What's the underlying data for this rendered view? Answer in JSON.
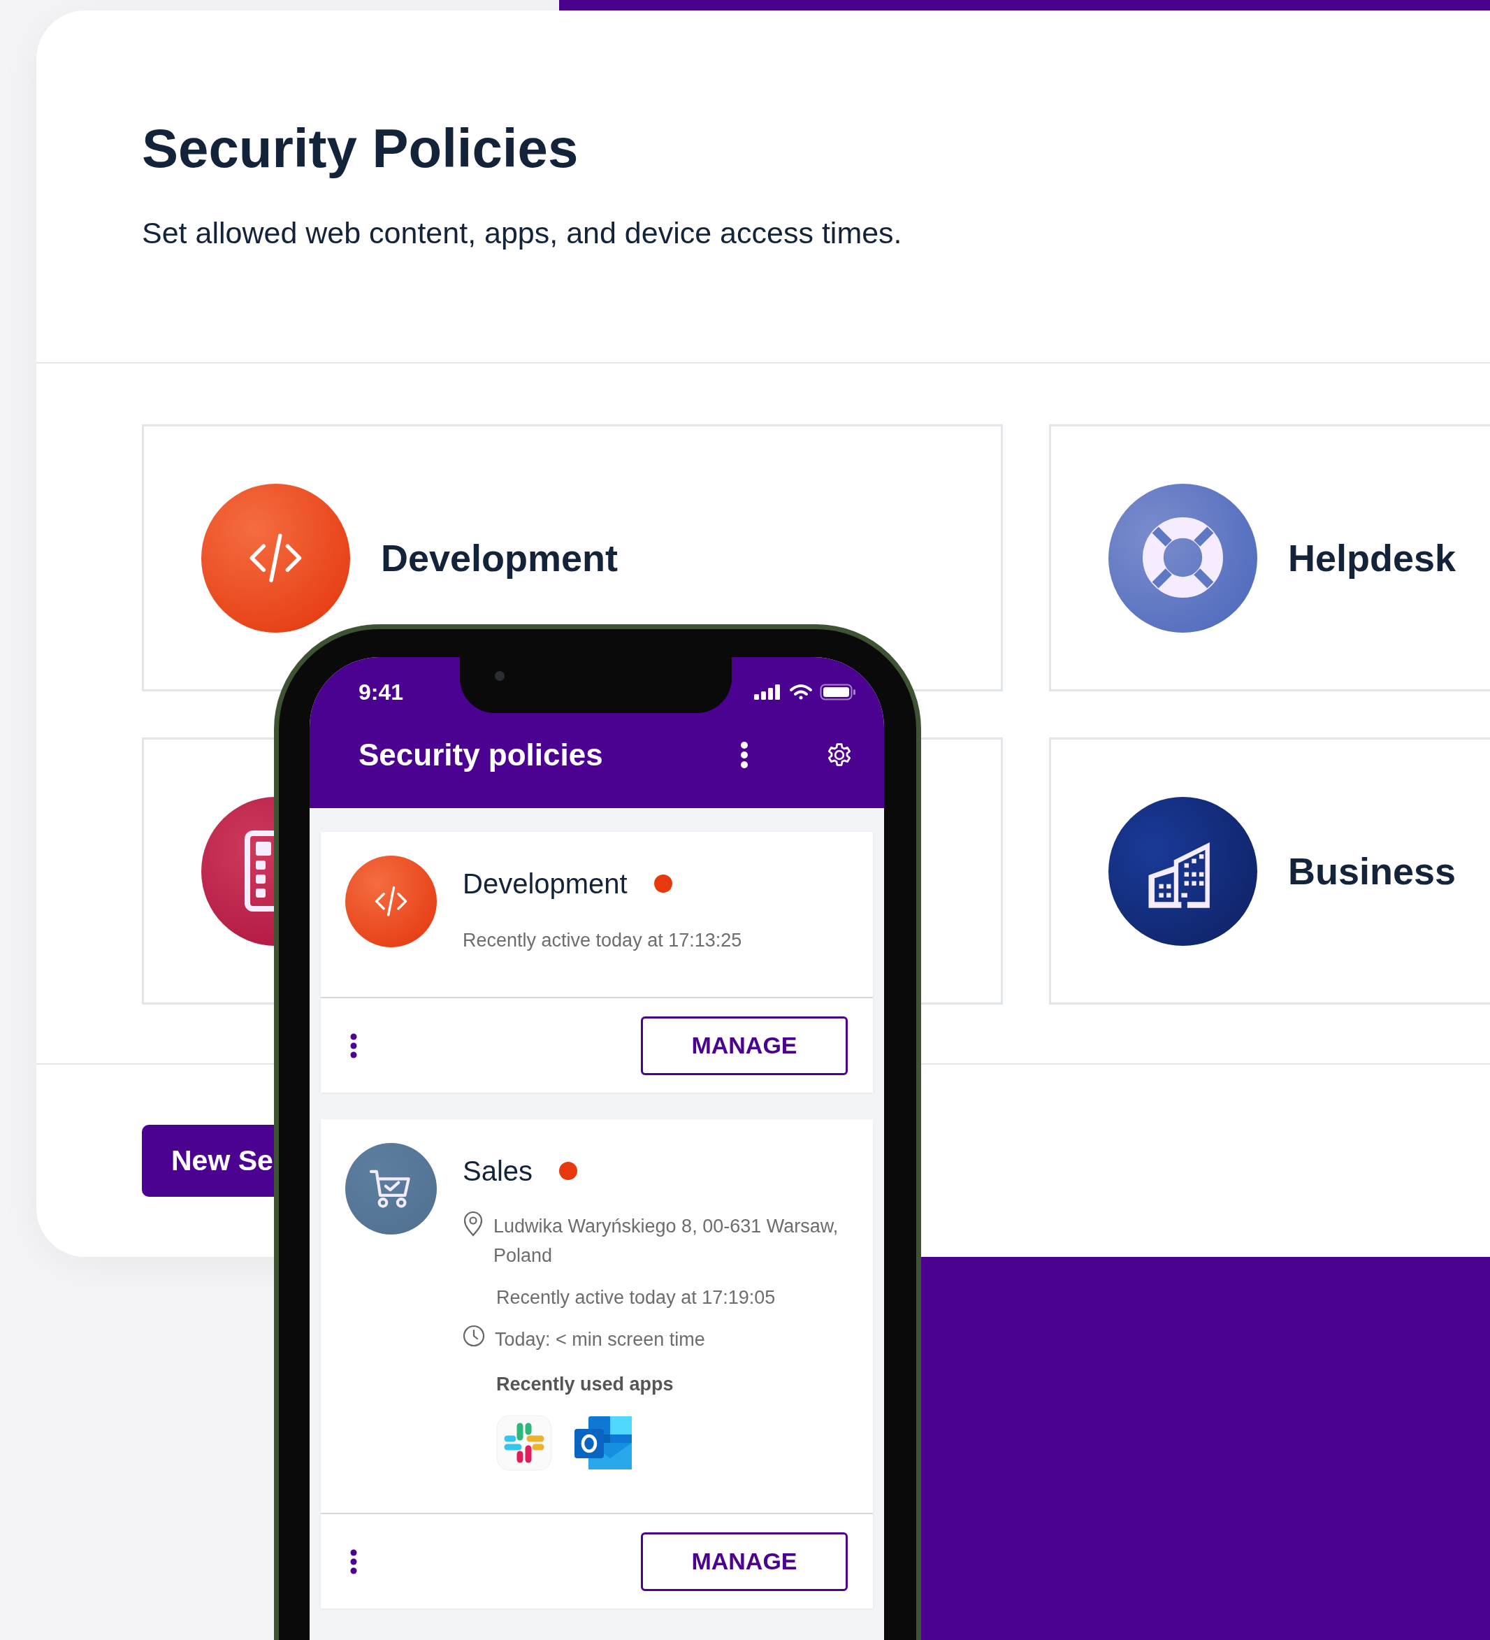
{
  "page": {
    "title": "Security Policies",
    "subtitle": "Set allowed web content, apps, and device access times."
  },
  "policy_tiles": [
    {
      "name": "Development",
      "kind": "code"
    },
    {
      "name": "Helpdesk",
      "kind": "lifebuoy"
    },
    {
      "kind": "grid"
    },
    {
      "name": "Business",
      "kind": "building"
    }
  ],
  "new_button": {
    "label": "New Se"
  },
  "phone": {
    "status_time": "9:41",
    "app_title": "Security policies",
    "policies": [
      {
        "name": "Development",
        "kind": "code",
        "color": "#e8380d",
        "last_active": "Recently active today at 17:13:25",
        "action": "MANAGE"
      },
      {
        "name": "Sales",
        "kind": "cart",
        "color": "#e8380d",
        "location": "Ludwika Waryńskiego 8, 00-631 Warsaw, Poland",
        "last_active": "Recently active today at 17:19:05",
        "screen_time": "Today: < min screen time",
        "apps_heading": "Recently used apps",
        "apps": [
          {
            "kind": "pinwheel"
          },
          {
            "kind": "envelope"
          }
        ],
        "action": "MANAGE"
      }
    ]
  }
}
